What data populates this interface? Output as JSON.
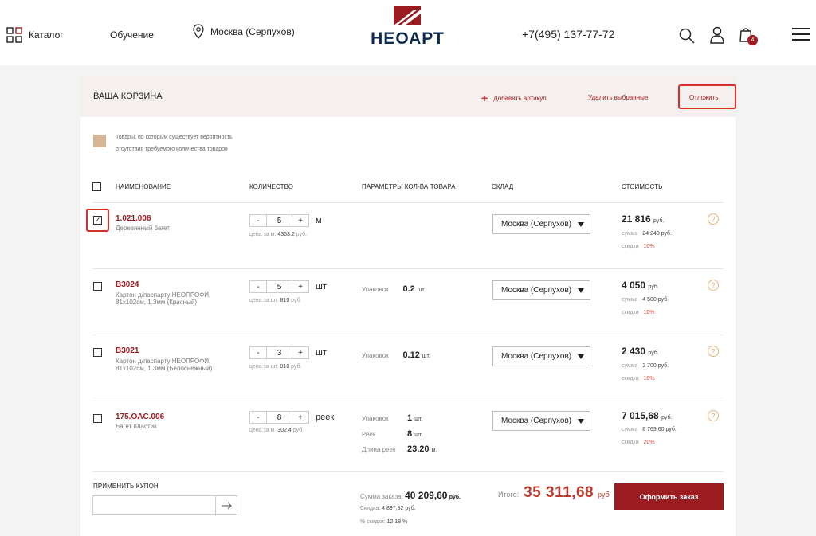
{
  "header": {
    "catalog": "Каталог",
    "learning": "Обучение",
    "location": "Москва (Серпухов)",
    "logo": "НЕОАРТ",
    "phone": "+7(495) 137-77-72",
    "cart_count": "4"
  },
  "cart": {
    "title": "ВАША КОРЗИНА",
    "add_article": "Добавить артикул",
    "delete_selected": "Удалить выбранные",
    "postpone": "Отложить",
    "legend": [
      "Товары, по которым существует вероятность",
      "отсутствия требуемого количества товаров"
    ],
    "columns": {
      "name": "НАИМЕНОВАНИЕ",
      "qty": "КОЛИЧЕСТВО",
      "params": "ПАРАМЕТРЫ КОЛ-ВА ТОВАРА",
      "warehouse": "СКЛАД",
      "cost": "СТОИМОСТЬ"
    },
    "items": [
      {
        "sku": "1.021.006",
        "desc1": "Деревянный багет",
        "desc2": "",
        "qty": "5",
        "unit": "м",
        "price_label": "цена за м.",
        "price": "4363.2",
        "price_unit": "руб.",
        "params": [],
        "warehouse": "Москва (Серпухов)",
        "cost": "21 816",
        "cost_unit": "руб.",
        "sum_label": "сумма",
        "sum": "24 240 руб.",
        "discount_label": "скидка",
        "discount": "10%",
        "checked": true
      },
      {
        "sku": "В3024",
        "desc1": "Картон д/паспарту НЕОПРОФИ,",
        "desc2": "81х102см, 1.3мм (Красный)",
        "qty": "5",
        "unit": "шт",
        "price_label": "цена за шт.",
        "price": "810",
        "price_unit": "руб.",
        "params": [
          {
            "label": "Упаковок",
            "value": "0.2",
            "unit": "шт."
          }
        ],
        "warehouse": "Москва (Серпухов)",
        "cost": "4 050",
        "cost_unit": "руб.",
        "sum_label": "сумма",
        "sum": "4 500 руб.",
        "discount_label": "скидка",
        "discount": "10%",
        "checked": false
      },
      {
        "sku": "В3021",
        "desc1": "Картон д/паспарту НЕОПРОФИ,",
        "desc2": "81х102см, 1.3мм (Белоснежный)",
        "qty": "3",
        "unit": "шт",
        "price_label": "цена за шт.",
        "price": "810",
        "price_unit": "руб.",
        "params": [
          {
            "label": "Упаковок",
            "value": "0.12",
            "unit": "шт."
          }
        ],
        "warehouse": "Москва (Серпухов)",
        "cost": "2 430",
        "cost_unit": "руб.",
        "sum_label": "сумма",
        "sum": "2 700 руб.",
        "discount_label": "скидка",
        "discount": "10%",
        "checked": false
      },
      {
        "sku": "175.OAC.006",
        "desc1": "Багет пластик",
        "desc2": "",
        "qty": "8",
        "unit": "реек",
        "price_label": "цена за м.",
        "price": "302.4",
        "price_unit": "руб.",
        "params": [
          {
            "label": "Упаковок",
            "value": "1",
            "unit": "шт."
          },
          {
            "label": "Реек",
            "value": "8",
            "unit": "шт."
          },
          {
            "label": "Длина реек",
            "value": "23.20",
            "unit": "м."
          }
        ],
        "warehouse": "Москва (Серпухов)",
        "cost": "7 015,68",
        "cost_unit": "руб.",
        "sum_label": "сумма",
        "sum": "8 769,60 руб.",
        "discount_label": "скидка",
        "discount": "20%",
        "checked": false
      }
    ],
    "coupon": {
      "label": "ПРИМЕНИТЬ КУПОН",
      "placeholder": ""
    },
    "summary": {
      "order_sum_label": "Сумма заказа:",
      "order_sum": "40 209,60",
      "order_sum_unit": "руб.",
      "discount_label": "Скидка:",
      "discount": "4 897,92 руб.",
      "discount_pct_label": "% скидки:",
      "discount_pct": "12.18 %"
    },
    "total": {
      "label": "Итого:",
      "value": "35 311,68",
      "unit": "руб"
    },
    "checkout": "Оформить заказ"
  },
  "colors": {
    "accent": "#9b1c20",
    "highlight": "#d9302b",
    "legend_swatch": "#d7b597"
  }
}
